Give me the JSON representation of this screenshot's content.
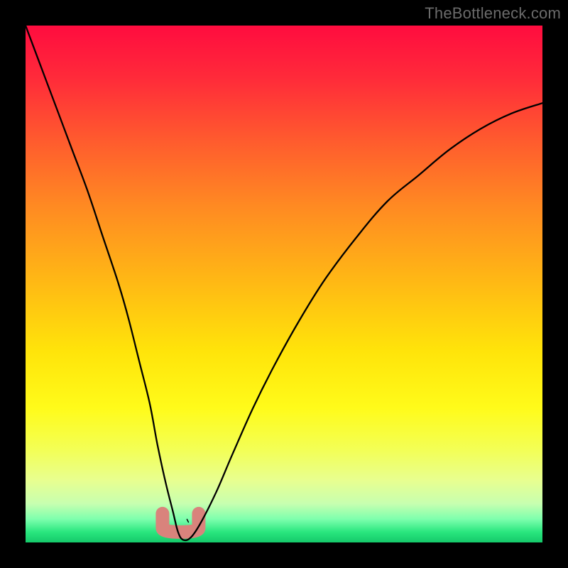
{
  "watermark": "TheBottleneck.com",
  "colors": {
    "frame": "#000000",
    "curve": "#000000",
    "nub": "#d9837c",
    "watermark": "#6b6b6b"
  },
  "gradient_stops": [
    {
      "offset": 0.0,
      "color": "#ff0c3f"
    },
    {
      "offset": 0.1,
      "color": "#ff2a3a"
    },
    {
      "offset": 0.22,
      "color": "#ff5a2e"
    },
    {
      "offset": 0.35,
      "color": "#ff8a22"
    },
    {
      "offset": 0.5,
      "color": "#ffba14"
    },
    {
      "offset": 0.63,
      "color": "#ffe40a"
    },
    {
      "offset": 0.74,
      "color": "#fffb1a"
    },
    {
      "offset": 0.82,
      "color": "#f3ff55"
    },
    {
      "offset": 0.88,
      "color": "#e8ff90"
    },
    {
      "offset": 0.925,
      "color": "#c7ffb0"
    },
    {
      "offset": 0.955,
      "color": "#7dffad"
    },
    {
      "offset": 0.98,
      "color": "#29e67e"
    },
    {
      "offset": 1.0,
      "color": "#15c96a"
    }
  ],
  "chart_data": {
    "type": "line",
    "title": "",
    "xlabel": "",
    "ylabel": "",
    "xlim": [
      0,
      100
    ],
    "ylim": [
      0,
      100
    ],
    "grid": false,
    "series": [
      {
        "name": "bottleneck-curve",
        "x": [
          0,
          3,
          6,
          9,
          12,
          15,
          18,
          20,
          22,
          24,
          25.5,
          27,
          28.5,
          29.5,
          30.5,
          32,
          34,
          37,
          40,
          44,
          48,
          53,
          58,
          64,
          70,
          76,
          82,
          88,
          94,
          100
        ],
        "y": [
          100,
          92,
          84,
          76,
          68,
          59,
          50,
          43,
          35,
          27,
          19,
          12,
          6,
          2,
          0.5,
          1,
          4,
          10,
          17,
          26,
          34,
          43,
          51,
          59,
          66,
          71,
          76,
          80,
          83,
          85
        ]
      }
    ],
    "annotations": [
      {
        "name": "optimal-range-marker",
        "x_range": [
          26.5,
          33.5
        ],
        "y": 2
      }
    ]
  }
}
